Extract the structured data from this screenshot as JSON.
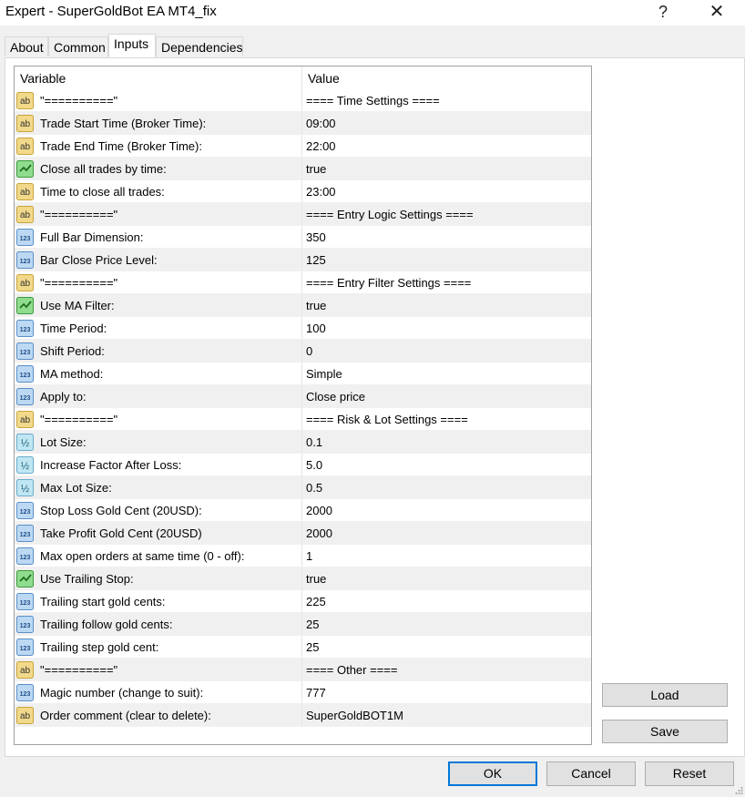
{
  "window": {
    "title": "Expert - SuperGoldBot EA MT4_fix",
    "help_glyph": "?",
    "close_glyph": "✕"
  },
  "tabs": [
    {
      "label": "About"
    },
    {
      "label": "Common"
    },
    {
      "label": "Inputs",
      "active": true
    },
    {
      "label": "Dependencies"
    }
  ],
  "grid": {
    "header": {
      "variable": "Variable",
      "value": "Value"
    },
    "rows": [
      {
        "icon": "string-icon",
        "name": "\"==========\"",
        "value": "==== Time Settings ===="
      },
      {
        "icon": "string-icon",
        "name": "Trade Start Time (Broker Time):",
        "value": "09:00"
      },
      {
        "icon": "string-icon",
        "name": "Trade End Time (Broker Time):",
        "value": "22:00"
      },
      {
        "icon": "bool-icon",
        "name": "Close all trades by time:",
        "value": "true"
      },
      {
        "icon": "string-icon",
        "name": "Time to close all trades:",
        "value": "23:00"
      },
      {
        "icon": "string-icon",
        "name": "\"==========\"",
        "value": "==== Entry Logic Settings ===="
      },
      {
        "icon": "integer-icon",
        "name": "Full Bar Dimension:",
        "value": "350"
      },
      {
        "icon": "integer-icon",
        "name": "Bar Close Price Level:",
        "value": "125"
      },
      {
        "icon": "string-icon",
        "name": "\"==========\"",
        "value": "==== Entry Filter Settings ===="
      },
      {
        "icon": "bool-icon",
        "name": "Use MA Filter:",
        "value": "true"
      },
      {
        "icon": "integer-icon",
        "name": "Time Period:",
        "value": "100"
      },
      {
        "icon": "integer-icon",
        "name": "Shift Period:",
        "value": "0"
      },
      {
        "icon": "integer-icon",
        "name": "MA method:",
        "value": "Simple"
      },
      {
        "icon": "integer-icon",
        "name": "Apply to:",
        "value": "Close price"
      },
      {
        "icon": "string-icon",
        "name": "\"==========\"",
        "value": "==== Risk & Lot Settings ===="
      },
      {
        "icon": "double-icon",
        "name": "Lot Size:",
        "value": "0.1"
      },
      {
        "icon": "double-icon",
        "name": "Increase Factor After Loss:",
        "value": "5.0"
      },
      {
        "icon": "double-icon",
        "name": "Max Lot Size:",
        "value": "0.5"
      },
      {
        "icon": "integer-icon",
        "name": "Stop Loss Gold Cent (20USD):",
        "value": "2000"
      },
      {
        "icon": "integer-icon",
        "name": "Take Profit Gold Cent (20USD)",
        "value": "2000"
      },
      {
        "icon": "integer-icon",
        "name": "Max open orders at same time (0 - off):",
        "value": "1"
      },
      {
        "icon": "bool-icon",
        "name": "Use Trailing Stop:",
        "value": "true"
      },
      {
        "icon": "integer-icon",
        "name": "Trailing start gold cents:",
        "value": "225"
      },
      {
        "icon": "integer-icon",
        "name": "Trailing follow gold cents:",
        "value": "25"
      },
      {
        "icon": "integer-icon",
        "name": "Trailing step gold cent:",
        "value": "25"
      },
      {
        "icon": "string-icon",
        "name": "\"==========\"",
        "value": "==== Other  ===="
      },
      {
        "icon": "integer-icon",
        "name": "Magic number (change to suit):",
        "value": "777"
      },
      {
        "icon": "string-icon",
        "name": "Order comment (clear to delete):",
        "value": "SuperGoldBOT1M"
      }
    ]
  },
  "side_buttons": {
    "load": "Load",
    "save": "Save"
  },
  "footer_buttons": {
    "ok": "OK",
    "cancel": "Cancel",
    "reset": "Reset"
  },
  "icon_text": {
    "string-icon": "ab",
    "integer-icon": "123",
    "double-icon": "½"
  },
  "colors": {
    "string_icon_bg": "#f2d98a",
    "string_icon_border": "#c9a43a",
    "integer_icon_bg": "#bcd8f2",
    "integer_icon_border": "#5a8fc8",
    "double_icon_bg": "#bfe6f2",
    "double_icon_border": "#6aaccc",
    "bool_icon_bg": "#8fdc8f",
    "bool_icon_border": "#3c9a3c",
    "default_button_border": "#0078d7"
  }
}
